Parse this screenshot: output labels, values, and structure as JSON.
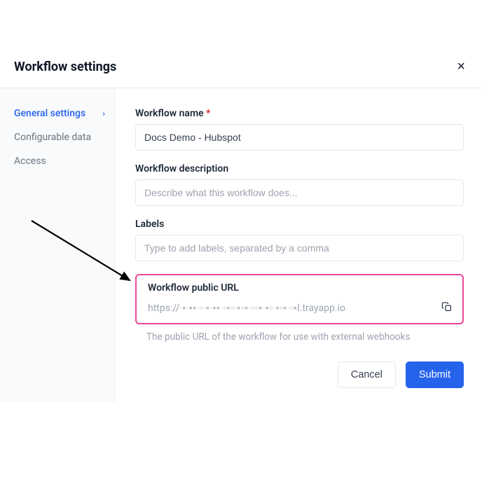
{
  "header": {
    "title": "Workflow settings",
    "close_label": "×"
  },
  "sidebar": {
    "items": [
      {
        "label": "General settings",
        "active": true
      },
      {
        "label": "Configurable data",
        "active": false
      },
      {
        "label": "Access",
        "active": false
      }
    ]
  },
  "form": {
    "name": {
      "label": "Workflow name",
      "required_marker": "*",
      "value": "Docs Demo - Hubspot"
    },
    "description": {
      "label": "Workflow description",
      "placeholder": "Describe what this workflow does..."
    },
    "labels": {
      "label": "Labels",
      "placeholder": "Type to add labels, separated by a comma"
    },
    "public_url": {
      "label": "Workflow public URL",
      "prefix": "https://",
      "obscured": "·▪·▪▪·▫·▪·▪▪·▫▪▫·▪▫▪·▫▫▪·▪▫·▪▫▪·▫▪",
      "suffix": "l.trayapp.io",
      "helper": "The public URL of the workflow for use with external webhooks"
    }
  },
  "footer": {
    "cancel": "Cancel",
    "submit": "Submit"
  }
}
